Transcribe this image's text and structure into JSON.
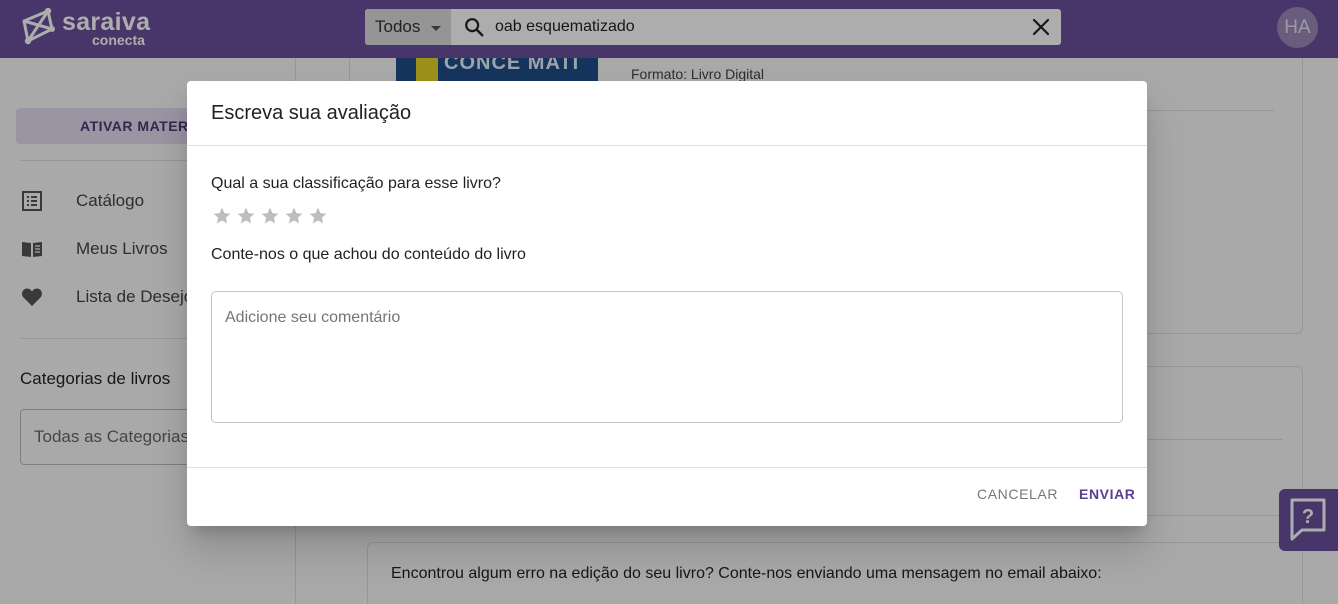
{
  "header": {
    "logo": {
      "line1": "saraiva",
      "line2": "conecta"
    },
    "search": {
      "scope": "Todos",
      "query": "oab esquematizado"
    },
    "avatar_initials": "HA"
  },
  "sidebar": {
    "activate_button": "ATIVAR MATERI",
    "items": [
      {
        "label": "Catálogo",
        "icon": "catalog-list-icon"
      },
      {
        "label": "Meus Livros",
        "icon": "open-book-icon"
      },
      {
        "label": "Lista de Desejo",
        "icon": "heart-icon"
      }
    ],
    "categories_title": "Categorias de livros",
    "categories_select": "Todas as Categorias"
  },
  "main": {
    "book_cover_text": "CONCE MATI",
    "format": "Formato: Livro Digital",
    "error_message": "Encontrou algum erro na edição do seu livro? Conte-nos enviando uma mensagem no email abaixo:"
  },
  "dialog": {
    "title": "Escreva sua avaliação",
    "rating_question": "Qual a sua classificação para esse livro?",
    "rating_value": 0,
    "rating_max": 5,
    "comment_prompt": "Conte-nos o que achou do conteúdo do livro",
    "comment_placeholder": "Adicione seu comentário",
    "cancel_label": "CANCELAR",
    "send_label": "ENVIAR"
  },
  "help_button": "?",
  "colors": {
    "brand": "#6b4f9c",
    "star_empty": "#bdbdbd",
    "send_text": "#5b3f94"
  }
}
